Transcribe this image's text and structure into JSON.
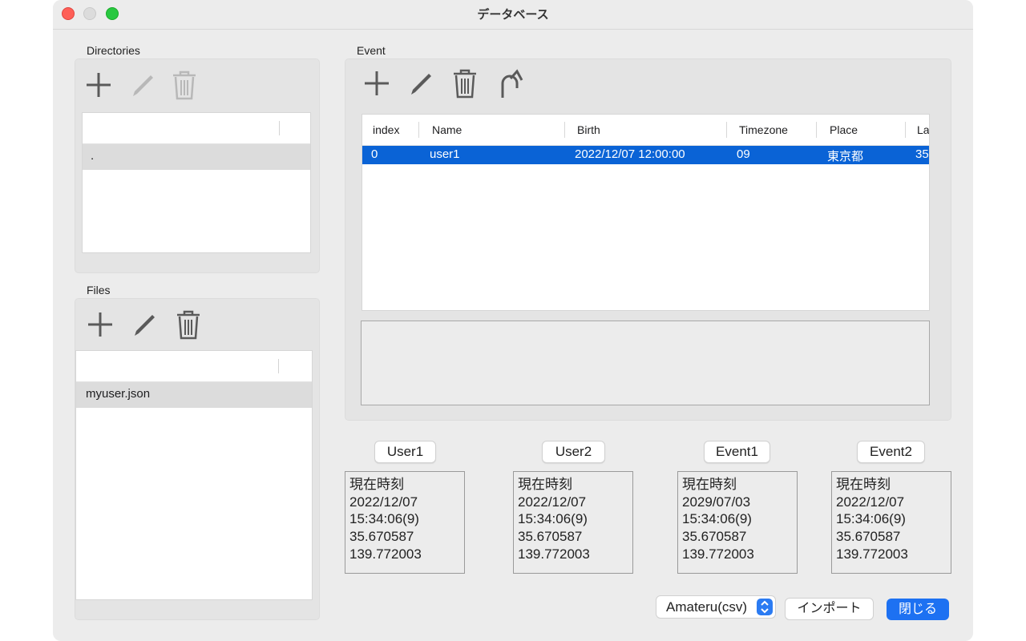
{
  "window": {
    "title": "データベース"
  },
  "directories": {
    "label": "Directories",
    "rows": [
      "."
    ]
  },
  "files": {
    "label": "Files",
    "rows": [
      "myuser.json"
    ]
  },
  "event": {
    "label": "Event",
    "columns": [
      "index",
      "Name",
      "Birth",
      "Timezone",
      "Place",
      "La"
    ],
    "rows": [
      {
        "index": "0",
        "name": "user1",
        "birth": "2022/12/07 12:00:00",
        "timezone": "09",
        "place": "東京都",
        "lat": "35"
      }
    ]
  },
  "panels": [
    {
      "button": "User1",
      "lines": [
        "現在時刻",
        "2022/12/07",
        "15:34:06(9)",
        "35.670587",
        "139.772003"
      ]
    },
    {
      "button": "User2",
      "lines": [
        "現在時刻",
        "2022/12/07",
        "15:34:06(9)",
        "35.670587",
        "139.772003"
      ]
    },
    {
      "button": "Event1",
      "lines": [
        "現在時刻",
        "2029/07/03",
        "15:34:06(9)",
        "35.670587",
        "139.772003"
      ]
    },
    {
      "button": "Event2",
      "lines": [
        "現在時刻",
        "2022/12/07",
        "15:34:06(9)",
        "35.670587",
        "139.772003"
      ]
    }
  ],
  "footer": {
    "format_select": "Amateru(csv)",
    "import_label": "インポート",
    "close_label": "閉じる"
  },
  "colors": {
    "accent": "#1d71f2",
    "selection": "#0a63d6",
    "close_light": "#fe5f57",
    "zoom_light": "#28c840"
  },
  "icons": [
    "plus-icon",
    "pencil-icon",
    "trash-icon",
    "undo-arrow-icon",
    "chevron-updown-icon"
  ]
}
